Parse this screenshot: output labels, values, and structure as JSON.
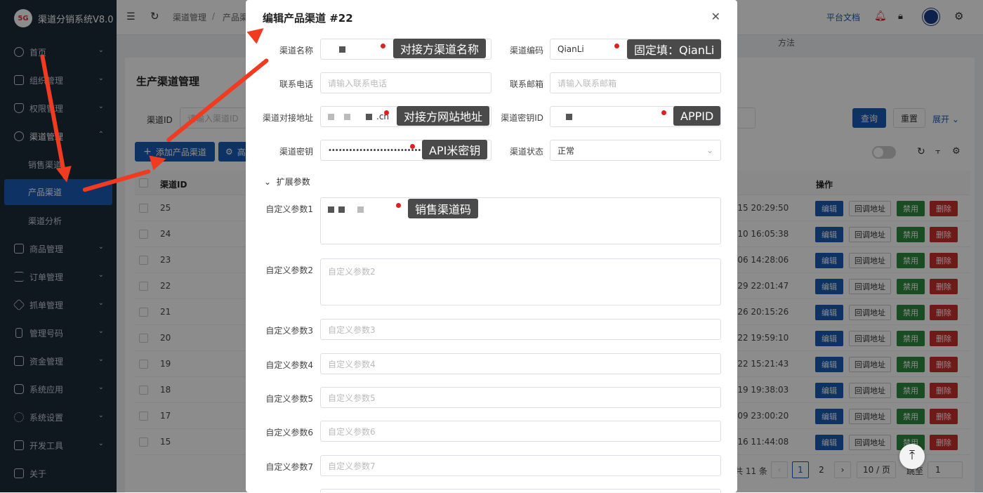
{
  "app": {
    "name": "渠道分销系统V8.0",
    "logo_text": "5G"
  },
  "sidebar": {
    "items": [
      {
        "label": "首页"
      },
      {
        "label": "组织管理"
      },
      {
        "label": "权限管理"
      },
      {
        "label": "渠道管理"
      },
      {
        "label": "销售渠道"
      },
      {
        "label": "产品渠道"
      },
      {
        "label": "渠道分析"
      },
      {
        "label": "商品管理"
      },
      {
        "label": "订单管理"
      },
      {
        "label": "抓单管理"
      },
      {
        "label": "管理号码"
      },
      {
        "label": "资金管理"
      },
      {
        "label": "系统应用"
      },
      {
        "label": "系统设置"
      },
      {
        "label": "开发工具"
      },
      {
        "label": "关于"
      }
    ]
  },
  "topbar": {
    "breadcrumb_1": "渠道管理",
    "separator": "/",
    "breadcrumb_2": "产品渠",
    "docs": "平台文档",
    "method": "方法"
  },
  "page": {
    "title": "生产渠道管理",
    "search_label": "渠道ID",
    "search_placeholder": "请输入渠道ID",
    "add_button": "添加产品渠道",
    "adv_button": "高",
    "query": "查询",
    "reset": "重置",
    "expand": "展开"
  },
  "table": {
    "headers": {
      "id": "渠道ID",
      "ops": "操作"
    },
    "rows": [
      {
        "id": "25",
        "time": "-15 20:29:50"
      },
      {
        "id": "24",
        "time": "-10 16:05:38"
      },
      {
        "id": "23",
        "time": "-06 14:28:06"
      },
      {
        "id": "22",
        "time": "-29 22:01:47"
      },
      {
        "id": "21",
        "time": "-26 20:15:26"
      },
      {
        "id": "20",
        "time": "-22 19:59:10"
      },
      {
        "id": "19",
        "time": "-22 15:21:43"
      },
      {
        "id": "18",
        "time": "-19 19:38:03"
      },
      {
        "id": "17",
        "time": "-09 23:00:20"
      },
      {
        "id": "15",
        "time": "-16 11:44:08"
      }
    ],
    "actions": {
      "edit": "编辑",
      "callback": "回调地址",
      "disable": "禁用",
      "delete": "删除"
    },
    "colors": {
      "edit": "#1b5bb5",
      "disable": "#2e8b3e",
      "delete": "#c9302c"
    }
  },
  "pagination": {
    "total": "共 11 条",
    "page1": "1",
    "page2": "2",
    "size": "10 / 页",
    "goto": "跳至",
    "goto_value": "1"
  },
  "modal": {
    "title": "编辑产品渠道 #22",
    "fields": {
      "name_label": "渠道名称",
      "code_label": "渠道编码",
      "code_value": "QianLi",
      "phone_label": "联系电话",
      "phone_ph": "请输入联系电话",
      "email_label": "联系邮箱",
      "email_ph": "请输入联系邮箱",
      "url_label": "渠道对接地址",
      "url_tail": ".cn",
      "keyid_label": "渠道密钥ID",
      "secret_label": "渠道密钥",
      "secret_value": "••••••••••••••••••••••••••••••••••",
      "status_label": "渠道状态",
      "status_value": "正常",
      "ext_toggle": "扩展参数",
      "p1_label": "自定义参数1",
      "p2_label": "自定义参数2",
      "p2_ph": "自定义参数2",
      "p3_label": "自定义参数3",
      "p3_ph": "自定义参数3",
      "p4_label": "自定义参数4",
      "p4_ph": "自定义参数4",
      "p5_label": "自定义参数5",
      "p5_ph": "自定义参数5",
      "p6_label": "自定义参数6",
      "p6_ph": "自定义参数6",
      "p7_label": "自定义参数7",
      "p7_ph": "自定义参数7"
    }
  },
  "callouts": {
    "name": "对接方渠道名称",
    "code": "固定填：QianLi",
    "url": "对接方网站地址",
    "appid": "APPID",
    "secret": "API米密钥",
    "param1": "销售渠道码"
  },
  "accent_color": "#1b5bb5",
  "arrow_color": "#f03b20"
}
